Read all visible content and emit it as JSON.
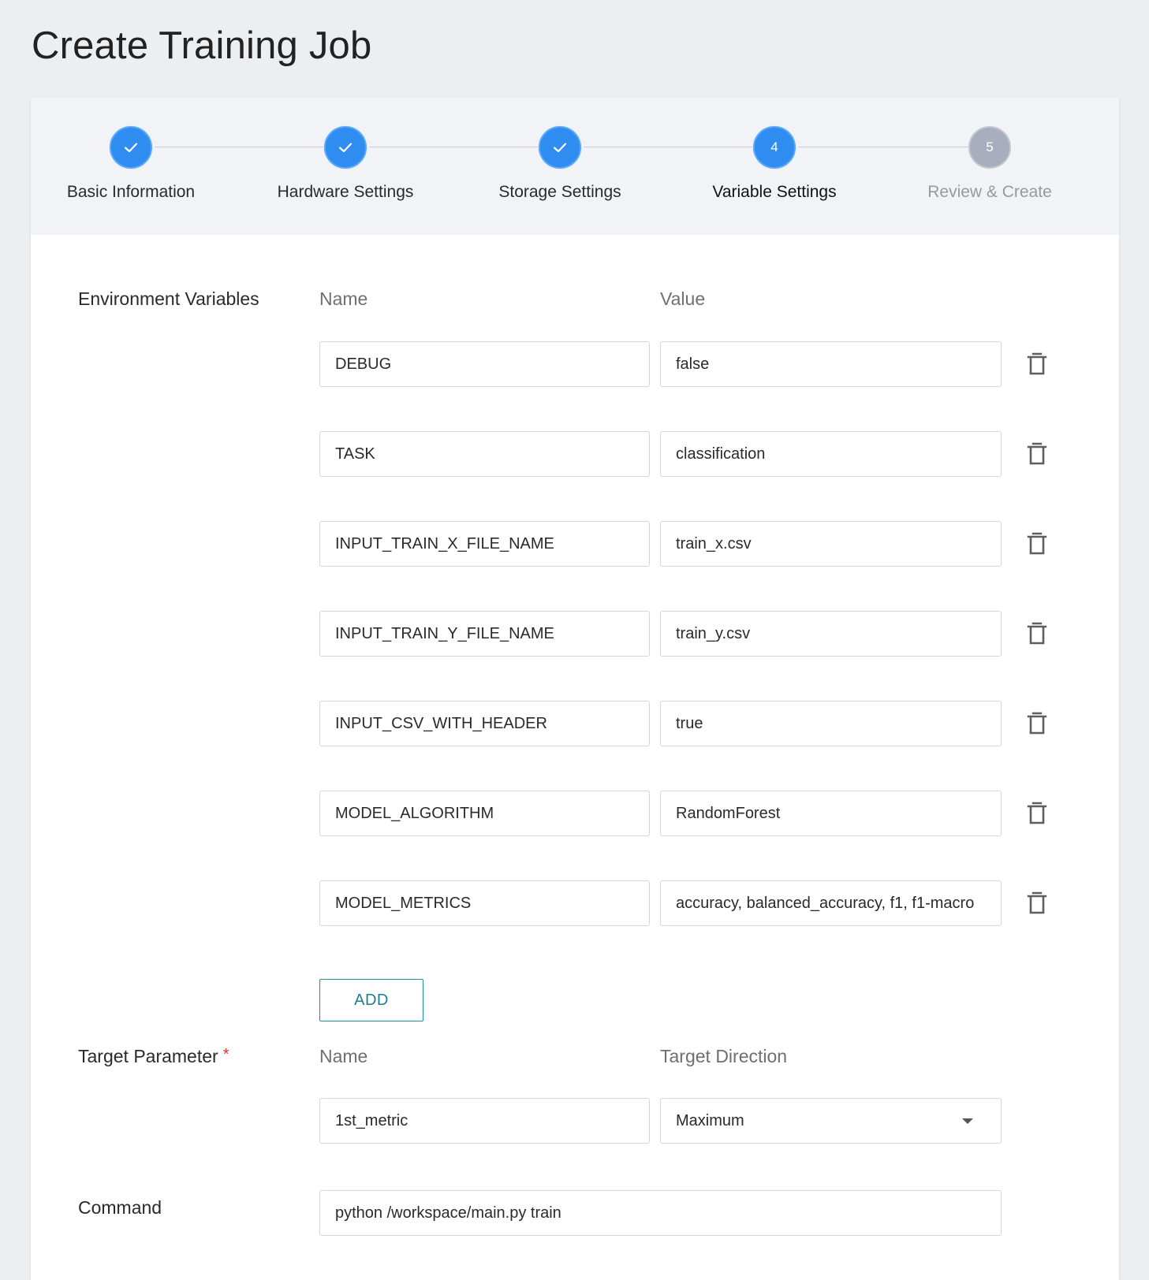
{
  "page": {
    "title": "Create Training Job"
  },
  "stepper": {
    "steps": [
      {
        "number": "1",
        "label": "Basic Information",
        "state": "done",
        "icon": "check-icon"
      },
      {
        "number": "2",
        "label": "Hardware Settings",
        "state": "done",
        "icon": "check-icon"
      },
      {
        "number": "3",
        "label": "Storage Settings",
        "state": "done",
        "icon": "check-icon"
      },
      {
        "number": "4",
        "label": "Variable Settings",
        "state": "active"
      },
      {
        "number": "5",
        "label": "Review & Create",
        "state": "pending"
      }
    ],
    "colors": {
      "active": "#2f8cf0",
      "pending": "#a8aebd"
    }
  },
  "env": {
    "label": "Environment Variables",
    "name_header": "Name",
    "value_header": "Value",
    "rows": [
      {
        "name": "DEBUG",
        "value": "false"
      },
      {
        "name": "TASK",
        "value": "classification"
      },
      {
        "name": "INPUT_TRAIN_X_FILE_NAME",
        "value": "train_x.csv"
      },
      {
        "name": "INPUT_TRAIN_Y_FILE_NAME",
        "value": "train_y.csv"
      },
      {
        "name": "INPUT_CSV_WITH_HEADER",
        "value": "true"
      },
      {
        "name": "MODEL_ALGORITHM",
        "value": "RandomForest"
      },
      {
        "name": "MODEL_METRICS",
        "value": "accuracy, balanced_accuracy, f1, f1-macro"
      }
    ],
    "delete_icon": "trash-icon",
    "add_label": "ADD"
  },
  "target": {
    "label": "Target Parameter",
    "required_mark": "*",
    "name_header": "Name",
    "direction_header": "Target Direction",
    "name_value": "1st_metric",
    "direction_value": "Maximum"
  },
  "command": {
    "label": "Command",
    "value": "python /workspace/main.py train"
  }
}
